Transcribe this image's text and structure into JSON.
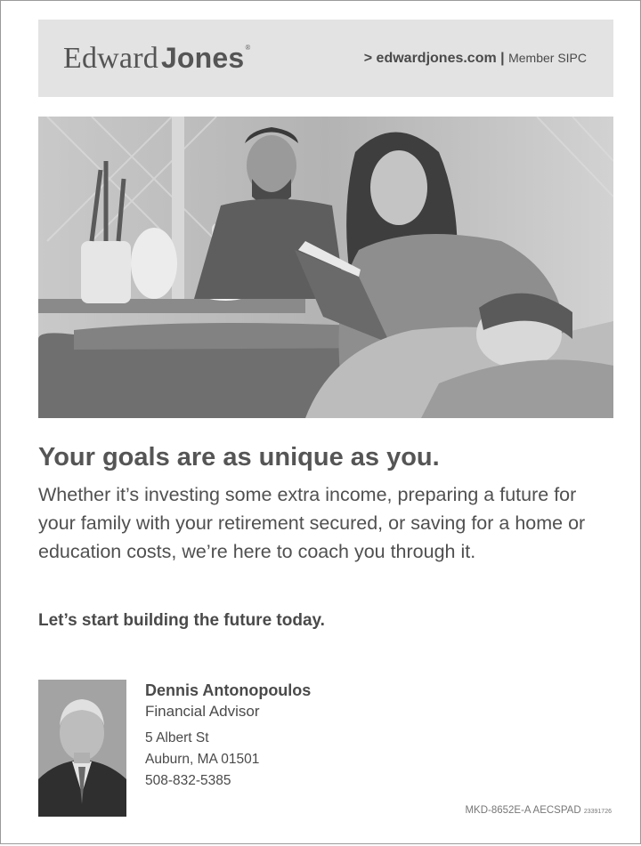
{
  "header": {
    "logo_light": "Edward",
    "logo_bold": "Jones",
    "logo_mark": "®",
    "url": "> edwardjones.com",
    "separator": " | ",
    "member": "Member SIPC"
  },
  "photo": {
    "icon": "family-reading-photo"
  },
  "main": {
    "headline": "Your goals are as unique as you.",
    "body": "Whether it’s investing some extra income, preparing a future for your family with your retirement secured, or saving for a home or education costs, we’re here to coach you through it.",
    "cta": "Let’s start building the future today."
  },
  "advisor": {
    "photo_icon": "advisor-portrait-photo",
    "name": "Dennis Antonopoulos",
    "title": "Financial Advisor",
    "address1": "5 Albert St",
    "address2": "Auburn, MA 01501",
    "phone": "508-832-5385"
  },
  "footer": {
    "code": "MKD-8652E-A AECSPAD",
    "code_small": "23391726"
  },
  "colors": {
    "header_bg": "#e3e3e3",
    "text": "#4a4a4a",
    "border": "#9a9a9a"
  }
}
